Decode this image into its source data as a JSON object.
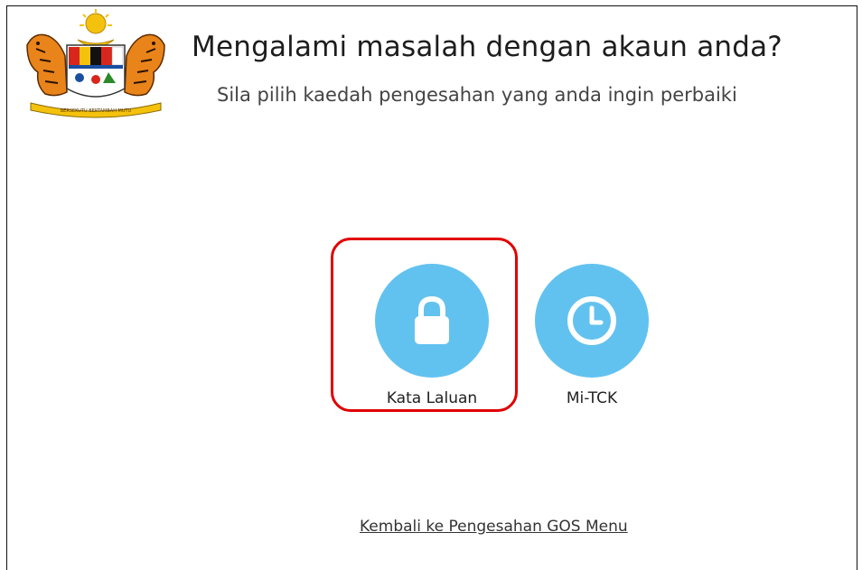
{
  "header": {
    "title": "Mengalami masalah dengan akaun anda?",
    "subtitle": "Sila pilih kaedah pengesahan yang anda ingin perbaiki",
    "crest_icon": "malaysia-coat-of-arms-icon",
    "crest_motto": "BERSEKUTU BERTAMBAH MUTU"
  },
  "options": [
    {
      "label": "Kata Laluan",
      "icon": "lock-icon",
      "highlighted": true
    },
    {
      "label": "Mi-TCK",
      "icon": "clock-icon",
      "highlighted": false
    }
  ],
  "footer": {
    "back_link": "Kembali ke Pengesahan GOS Menu"
  },
  "colors": {
    "option_circle": "#62c2ef",
    "highlight_border": "#e00000",
    "icon_fill": "#ffffff"
  }
}
